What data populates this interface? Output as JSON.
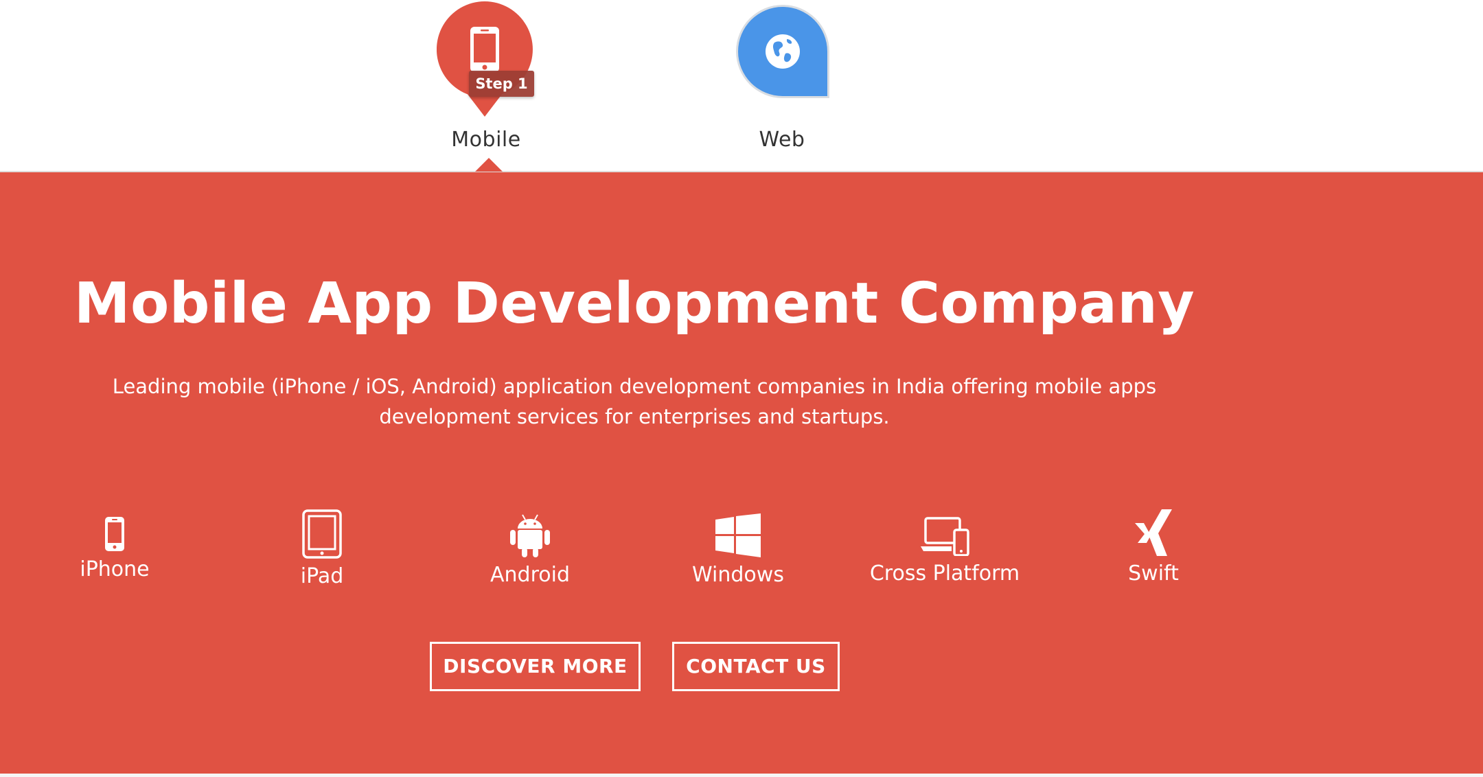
{
  "tabs": [
    {
      "label": "Mobile",
      "icon": "mobile-phone-icon",
      "active": true,
      "color": "#e05243"
    },
    {
      "label": "Web",
      "icon": "globe-icon",
      "active": false,
      "color": "#4a95e8"
    }
  ],
  "tooltip": {
    "text": "Step 1"
  },
  "hero": {
    "background": "#e05243",
    "title": "Mobile App Development Company",
    "description": "Leading mobile (iPhone / iOS, Android) application development companies in India offering mobile apps development services for enterprises and startups."
  },
  "platforms": [
    {
      "label": "iPhone",
      "icon": "iphone-icon"
    },
    {
      "label": "iPad",
      "icon": "ipad-icon"
    },
    {
      "label": "Android",
      "icon": "android-icon"
    },
    {
      "label": "Windows",
      "icon": "windows-icon"
    },
    {
      "label": "Cross Platform",
      "icon": "cross-platform-icon"
    },
    {
      "label": "Swift",
      "icon": "swift-icon"
    }
  ],
  "buttons": {
    "discover": "DISCOVER MORE",
    "contact": "CONTACT US"
  }
}
